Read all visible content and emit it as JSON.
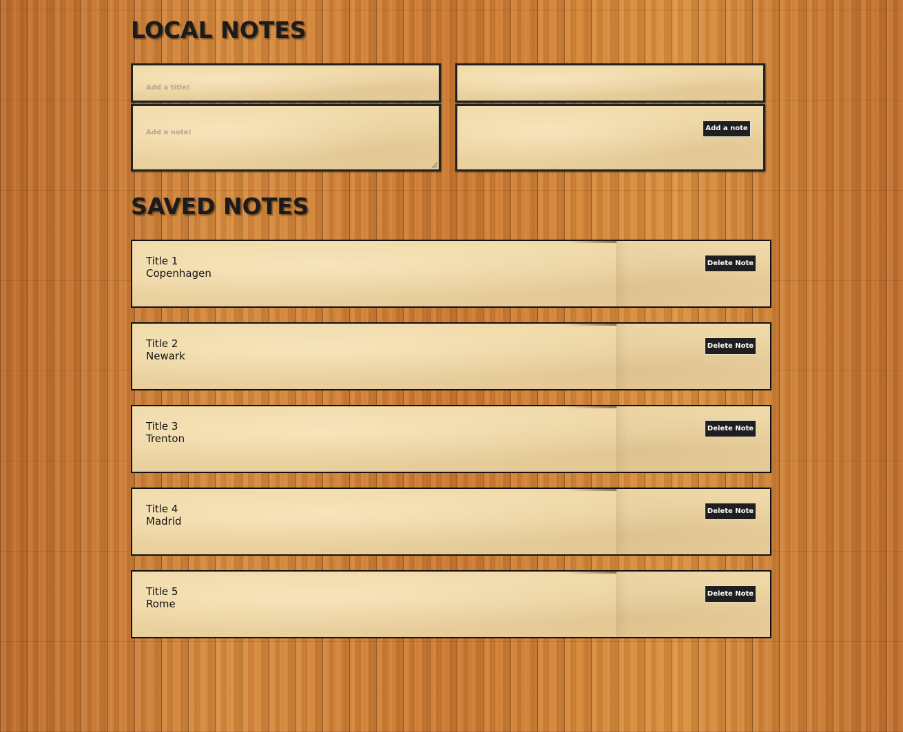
{
  "local_heading": "LOCAL NOTES",
  "saved_heading": "SAVED NOTES",
  "form": {
    "title_placeholder": "Add a title!",
    "note_placeholder": "Add a note!",
    "add_button_label": "Add a note"
  },
  "notes": [
    {
      "title": "Title 1",
      "body": "Copenhagen",
      "delete_label": "Delete Note"
    },
    {
      "title": "Title 2",
      "body": "Newark",
      "delete_label": "Delete Note"
    },
    {
      "title": "Title 3",
      "body": "Trenton",
      "delete_label": "Delete Note"
    },
    {
      "title": "Title 4",
      "body": "Madrid",
      "delete_label": "Delete Note"
    },
    {
      "title": "Title 5",
      "body": "Rome",
      "delete_label": "Delete Note"
    }
  ],
  "icons": {
    "resize_grip": "resize-grip-icon"
  }
}
